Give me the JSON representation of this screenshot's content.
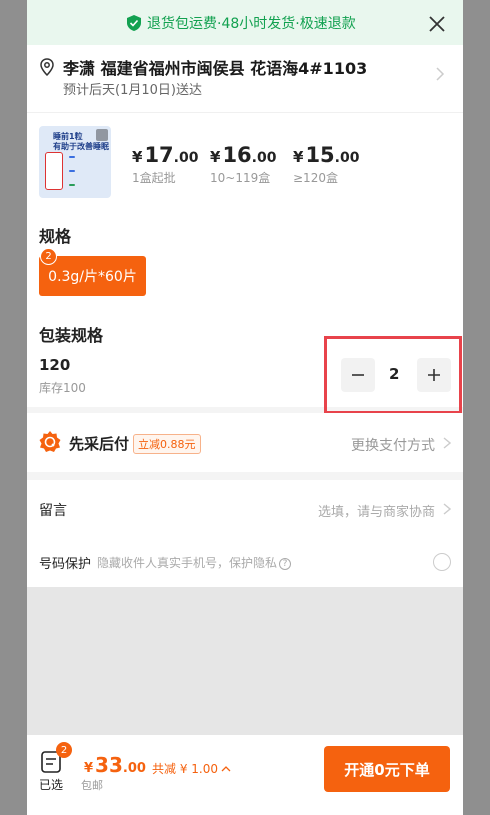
{
  "banner": {
    "text": "退货包运费·48小时发货·极速退款"
  },
  "address": {
    "name_line": "李潇 福建省福州市闽侯县 花语海4#1103",
    "delivery": "预计后天(1月10日)送达"
  },
  "product": {
    "thumb_title": "睡前1粒\n有助于改善睡眠",
    "prices": [
      {
        "currency": "¥",
        "integer": "17",
        "decimal": ".00",
        "note": "1盒起批"
      },
      {
        "currency": "¥",
        "integer": "16",
        "decimal": ".00",
        "note": "10~119盒"
      },
      {
        "currency": "¥",
        "integer": "15",
        "decimal": ".00",
        "note": "≥120盒"
      }
    ]
  },
  "spec": {
    "title": "规格",
    "option": "0.3g/片*60片",
    "badge": "2"
  },
  "packaging": {
    "title": "包装规格",
    "value": "120",
    "stock": "库存100",
    "quantity": "2"
  },
  "payment": {
    "label": "先采后付",
    "tag": "立减0.88元",
    "change": "更换支付方式"
  },
  "message": {
    "label": "留言",
    "hint": "选填，请与商家协商"
  },
  "privacy": {
    "label": "号码保护",
    "hint": "隐藏收件人真实手机号，保护隐私"
  },
  "footer": {
    "cart_badge": "2",
    "cart_label": "已选",
    "currency": "¥",
    "total_int": "33",
    "total_dec": ".00",
    "discount": "共减 ¥ 1.00",
    "shipping": "包邮",
    "order_button": "开通0元下单"
  },
  "colors": {
    "accent": "#f5620f",
    "banner_green": "#12a150",
    "highlight_red": "#e8434b"
  }
}
